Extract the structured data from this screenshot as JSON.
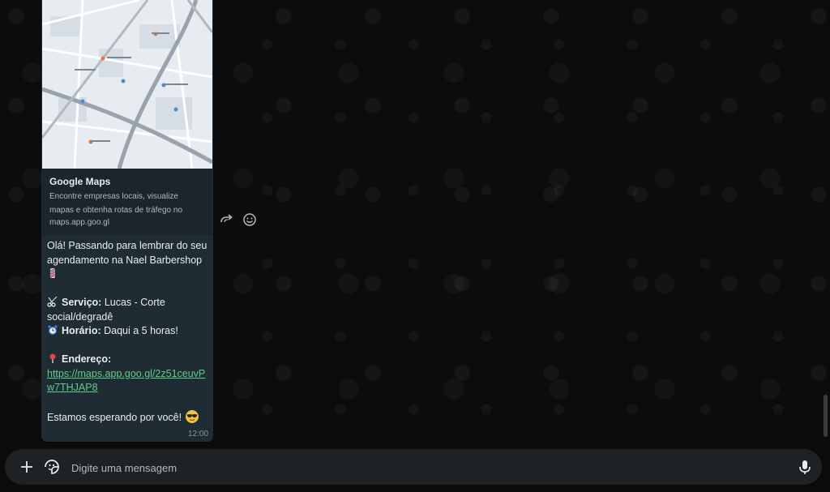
{
  "preview": {
    "title": "Google Maps",
    "description": "Encontre empresas locais, visualize mapas e obtenha rotas de tráfego no",
    "domain": "maps.app.goo.gl"
  },
  "message": {
    "line1": "Olá! Passando para lembrar do seu",
    "line2": "agendamento na Nael Barbershop",
    "service_label": "Serviço:",
    "service_value": " Lucas - Corte",
    "service_value2": "social/degradê",
    "time_label": "Horário:",
    "time_value": " Daqui a 5 horas!",
    "address_label": "Endereço:",
    "link_line1": "https://maps.app.goo.gl/2z51ceuvP",
    "link_line2": "w7THJAP8",
    "closing": "Estamos esperando por você!",
    "timestamp": "12:00"
  },
  "composer": {
    "placeholder": "Digite uma mensagem"
  },
  "icons": {
    "forward": "forward-icon",
    "react": "smiley-icon",
    "attach": "plus-icon",
    "sticker": "sticker-icon",
    "mic": "microphone-icon"
  },
  "colors": {
    "bubble": "#202c33",
    "link": "#5ccf8a",
    "composer": "#1f2225"
  }
}
